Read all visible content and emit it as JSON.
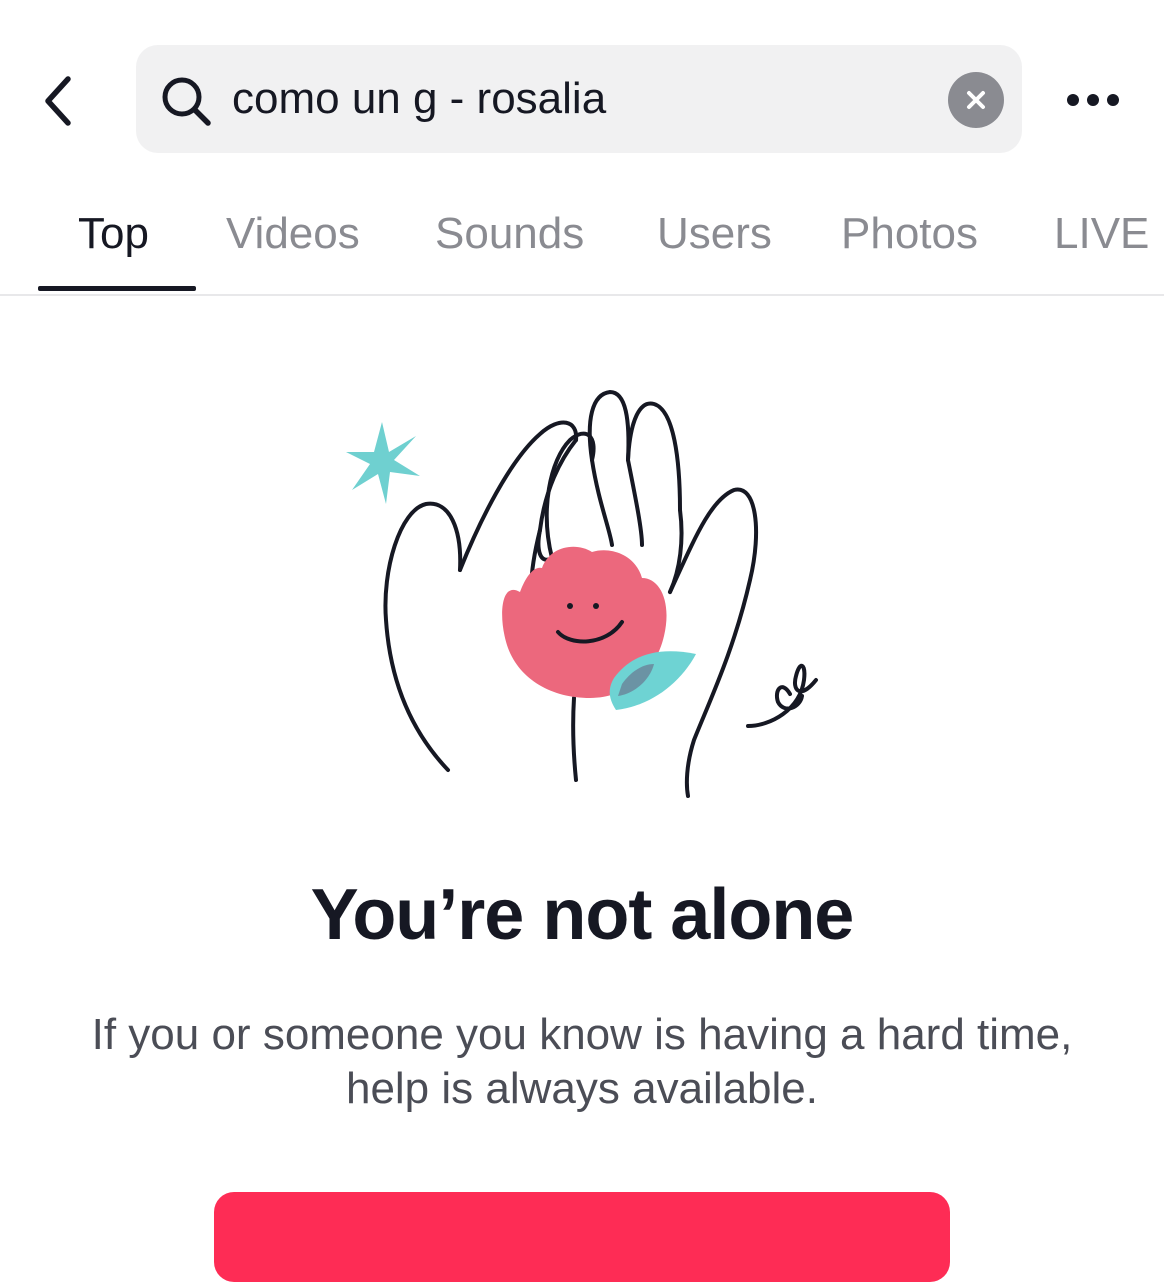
{
  "search": {
    "query": "como un g - rosalia"
  },
  "tabs": [
    {
      "label": "Top",
      "active": true
    },
    {
      "label": "Videos",
      "active": false
    },
    {
      "label": "Sounds",
      "active": false
    },
    {
      "label": "Users",
      "active": false
    },
    {
      "label": "Photos",
      "active": false
    },
    {
      "label": "LIVE",
      "active": false
    }
  ],
  "message": {
    "headline": "You’re not alone",
    "body": "If you or someone you know is having a hard time, help is always available."
  },
  "colors": {
    "accent": "#fe2c55",
    "flower": "#ec687d",
    "leaf": "#6ed3d3",
    "sparkle": "#6fd0d0"
  },
  "icons": {
    "back": "chevron-left-icon",
    "search": "search-icon",
    "clear": "close-icon",
    "more": "more-horizontal-icon"
  }
}
